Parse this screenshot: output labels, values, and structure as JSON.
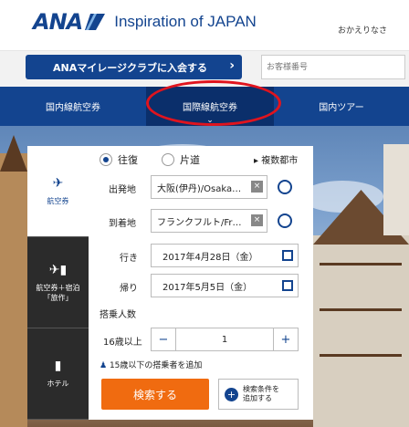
{
  "header": {
    "logo_text": "ANA",
    "tagline": "Inspiration of JAPAN",
    "right_text": "おかえりなさ"
  },
  "subbar": {
    "join_label": "ANAマイレージクラブに入会する",
    "login_placeholder": "お客様番号"
  },
  "nav": {
    "items": [
      {
        "label": "国内線航空券"
      },
      {
        "label": "国際線航空券"
      },
      {
        "label": "国内ツアー"
      }
    ],
    "active_index": 1
  },
  "side_tabs": [
    {
      "label": "航空券",
      "icon": "plane-icon"
    },
    {
      "label": "航空券＋宿泊\n「旅作」",
      "icon": "plane-building-icon"
    },
    {
      "label": "ホテル",
      "icon": "building-icon"
    }
  ],
  "form": {
    "trip_roundtrip": "往復",
    "trip_oneway": "片道",
    "multi_city": "▸ 複数都市",
    "from_label": "出発地",
    "from_value": "大阪(伊丹)/Osaka…",
    "to_label": "到着地",
    "to_value": "フランクフルト/Fr…",
    "depart_label": "行き",
    "depart_value": "2017年4月28日（金）",
    "return_label": "帰り",
    "return_value": "2017年5月5日（金）",
    "pax_label": "搭乗人数",
    "adult_label": "16歳以上",
    "adult_count": "1",
    "minus": "−",
    "plus": "+",
    "add_child": "15歳以下の搭乗者を追加",
    "search_label": "検索する",
    "more_conditions": "検索条件を\n追加する"
  },
  "colors": {
    "brand": "#13448f",
    "accent": "#f06b10",
    "highlight": "#e0141e"
  }
}
